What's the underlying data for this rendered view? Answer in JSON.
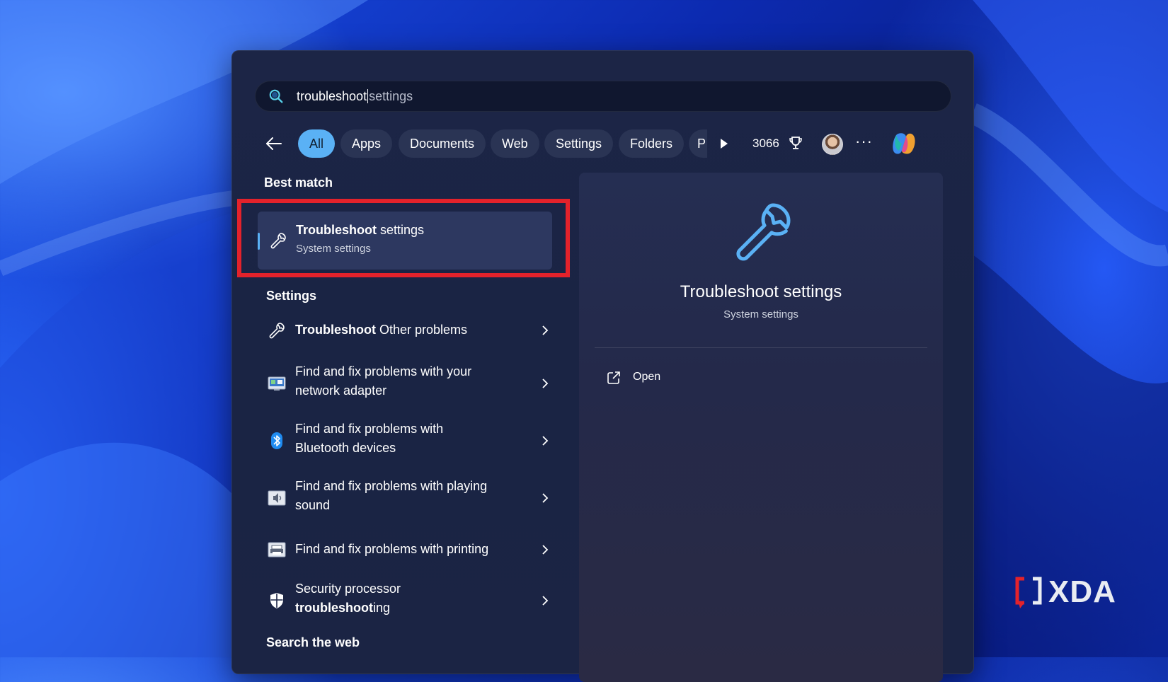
{
  "search": {
    "typed": "troubleshoot",
    "suggestion": "settings"
  },
  "filters": {
    "chips": [
      "All",
      "Apps",
      "Documents",
      "Web",
      "Settings",
      "Folders",
      "P"
    ],
    "active": "All",
    "points": "3066"
  },
  "sections": {
    "best_match": "Best match",
    "settings": "Settings",
    "search_web": "Search the web"
  },
  "best_match": {
    "title_bold": "Troubleshoot",
    "title_rest": " settings",
    "subtitle": "System settings"
  },
  "settings_items": [
    {
      "icon": "wrench-icon",
      "bold": "Troubleshoot",
      "rest": " Other problems"
    },
    {
      "icon": "network-adapter-icon",
      "line1": "Find and fix problems with your",
      "line2": "network adapter"
    },
    {
      "icon": "bluetooth-icon",
      "line1": "Find and fix problems with",
      "line2": "Bluetooth devices"
    },
    {
      "icon": "sound-icon",
      "line1": "Find and fix problems with playing",
      "line2": "sound"
    },
    {
      "icon": "printer-icon",
      "line1": "Find and fix problems with printing"
    },
    {
      "icon": "shield-icon",
      "line1": "Security processor",
      "line2_bold": "troubleshoot",
      "line2_rest": "ing"
    }
  ],
  "preview": {
    "title": "Troubleshoot settings",
    "subtitle": "System settings",
    "action": "Open"
  },
  "watermark": "XDA",
  "colors": {
    "accent": "#5ab1f5",
    "highlight": "#e3222b",
    "panel": "#1c2546"
  }
}
